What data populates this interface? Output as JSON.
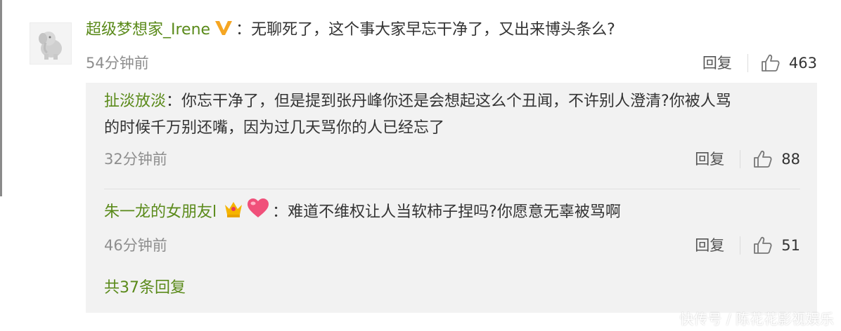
{
  "colors": {
    "username": "#5a8a1a",
    "text": "#333333",
    "meta": "#8e8e8e",
    "reply_bg": "#f2f2f2",
    "vip_badge": "#f5a623"
  },
  "main_comment": {
    "username": "超级梦想家_Irene",
    "badge": "vip-v-icon",
    "separator": "：",
    "text": "无聊死了，这个事大家早忘干净了，又出来博头条么?",
    "time": "54分钟前",
    "reply_label": "回复",
    "likes": "463"
  },
  "replies": [
    {
      "username": "扯淡放淡",
      "separator": "：",
      "text_line1": "你忘干净了，但是提到张丹峰你还是会想起这么个丑闻，不许别人澄清?你被人骂",
      "text_line2": "的时候千万别还嘴，因为过几天骂你的人已经忘了",
      "time": "32分钟前",
      "reply_label": "回复",
      "likes": "88"
    },
    {
      "username": "朱一龙的女朋友l",
      "badges": [
        "crown-icon",
        "heart-icon"
      ],
      "separator": "：",
      "text": "难道不维权让人当软柿子捏吗?你愿意无辜被骂啊",
      "time": "46分钟前",
      "reply_label": "回复",
      "likes": "51"
    }
  ],
  "more_replies": "共37条回复",
  "watermark": "快传号 / 陈花花影视娱乐"
}
